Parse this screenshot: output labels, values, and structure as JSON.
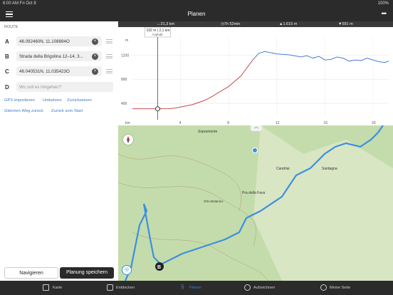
{
  "status": {
    "time": "6:00 AM  Fri Oct 8",
    "battery": "100%"
  },
  "header": {
    "title": "Planen",
    "more": "•••"
  },
  "sidebar": {
    "section_label": "ROUTE",
    "waypoints": [
      {
        "letter": "A",
        "value": "46.092460N, 11.108894O"
      },
      {
        "letter": "B",
        "value": "Strada della Brigolina 12–14, 3..."
      },
      {
        "letter": "C",
        "value": "46.040531N, 11.035423O"
      },
      {
        "letter": "D",
        "placeholder": "Wo soll es hingehen?"
      }
    ],
    "links": {
      "gpx_import": "GPX importieren",
      "reverse": "Umkehren",
      "reset": "Zurücksetzen",
      "same_way_back": "Gleichen Weg zurück",
      "back_to_start": "Zurück zum Start"
    },
    "buttons": {
      "navigate": "Navigieren",
      "save": "Planung speichern"
    }
  },
  "stats": {
    "distance": "↔21,3 km",
    "duration": "◷7h 52min",
    "ascent": "▲1.615 m",
    "descent": "▼591 m"
  },
  "chart_data": {
    "type": "line",
    "xlabel": "km",
    "ylabel": "m",
    "x_ticks": [
      4,
      8,
      12,
      16,
      20
    ],
    "y_ticks": [
      400,
      800,
      1200
    ],
    "xlim": [
      0,
      21.3
    ],
    "ylim": [
      200,
      1500
    ],
    "cursor_label": "192 m | 2,1 km",
    "cursor_sublabel": "Asphalt",
    "series": [
      {
        "color": "#c23030",
        "x": [
          0,
          1,
          2,
          3,
          3.5,
          4,
          5,
          6,
          6.5,
          7,
          8,
          9,
          10
        ],
        "y": [
          310,
          310,
          310,
          312,
          320,
          340,
          380,
          450,
          500,
          560,
          680,
          850,
          1120
        ]
      },
      {
        "color": "#3a6bc8",
        "x": [
          10,
          10.5,
          11,
          12,
          13,
          14,
          14.5,
          15,
          15.5,
          16,
          16.5,
          17,
          17.5,
          18,
          18.5,
          19,
          19.5,
          20,
          20.5,
          21,
          21.3
        ],
        "y": [
          1120,
          1230,
          1260,
          1220,
          1205,
          1170,
          1190,
          1150,
          1180,
          1120,
          1130,
          1170,
          1150,
          1100,
          1120,
          1110,
          1150,
          1120,
          1090,
          1080,
          1100
        ]
      }
    ]
  },
  "map": {
    "labels": [
      "Sopramonte",
      "Candriai",
      "Sardagna",
      "Pra della Fava",
      "Orto Botanico"
    ],
    "marker_label": "B",
    "attribution": "© Outdooractive",
    "controls": [
      "walk-icon",
      "undo-icon",
      "redo-icon",
      "magic-icon"
    ]
  },
  "tabs": [
    {
      "label": "Karte",
      "icon": "map-icon"
    },
    {
      "label": "Entdecken",
      "icon": "discover-icon"
    },
    {
      "label": "Planen",
      "icon": "plan-icon",
      "active": true
    },
    {
      "label": "Aufzeichnen",
      "icon": "record-icon"
    },
    {
      "label": "Meine Seite",
      "icon": "profile-icon"
    }
  ]
}
